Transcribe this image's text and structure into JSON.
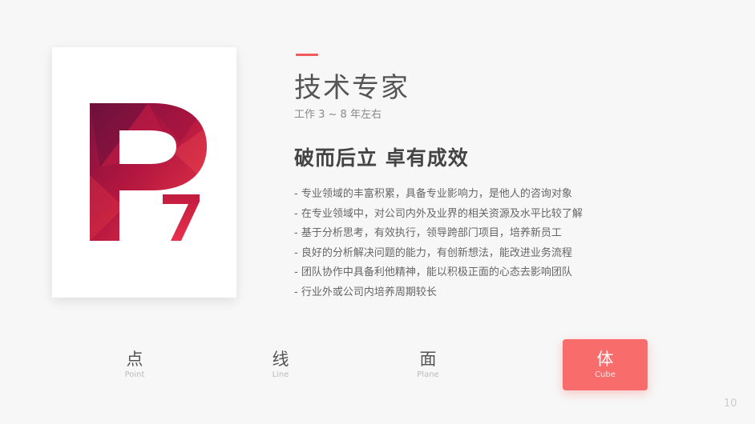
{
  "card": {
    "logo_letter": "P",
    "logo_number": "7"
  },
  "colors": {
    "accent": "#f15b5b",
    "active_nav": "#f86c6c",
    "logo_deep": "#a8123f",
    "logo_bright": "#e8314e"
  },
  "header": {
    "title": "技术专家",
    "subtitle": "工作 3 ~ 8 年左右"
  },
  "slogan": "破而后立 卓有成效",
  "bullets": [
    "- 专业领域的丰富积累，具备专业影响力，是他人的咨询对象",
    "- 在专业领域中，对公司内外及业界的相关资源及水平比较了解",
    "- 基于分析思考，有效执行，领导跨部门项目，培养新员工",
    "- 良好的分析解决问题的能力，有创新想法，能改进业务流程",
    "- 团队协作中具备利他精神，能以积极正面的心态去影响团队",
    "- 行业外或公司内培养周期较长"
  ],
  "nav": [
    {
      "zh": "点",
      "en": "Point",
      "active": false
    },
    {
      "zh": "线",
      "en": "Line",
      "active": false
    },
    {
      "zh": "面",
      "en": "Plane",
      "active": false
    },
    {
      "zh": "体",
      "en": "Cube",
      "active": true
    }
  ],
  "page_number": "10"
}
